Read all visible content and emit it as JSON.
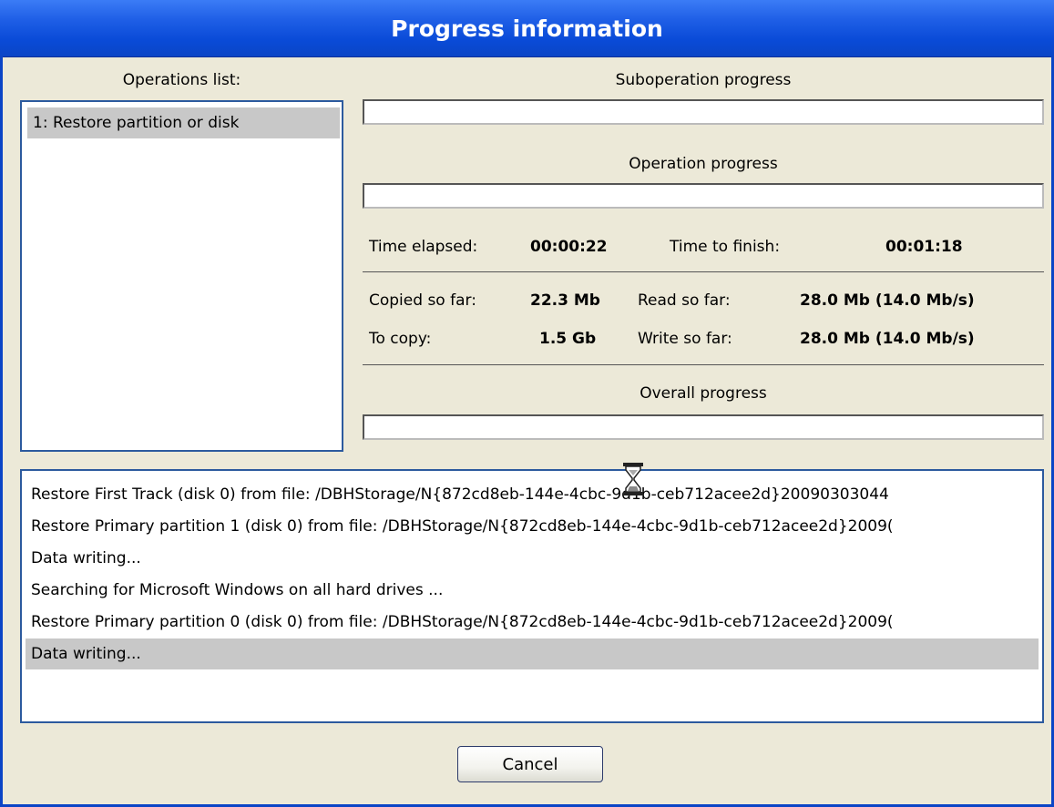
{
  "window": {
    "title": "Progress information"
  },
  "operations": {
    "label": "Operations list:",
    "items": [
      "1: Restore partition or disk"
    ]
  },
  "suboperation": {
    "label": "Suboperation progress",
    "progress": 0
  },
  "operation": {
    "label": "Operation progress",
    "progress": 0
  },
  "stats": {
    "time_elapsed_label": "Time elapsed:",
    "time_elapsed_value": "00:00:22",
    "time_to_finish_label": "Time to finish:",
    "time_to_finish_value": "00:01:18",
    "copied_label": "Copied so far:",
    "copied_value": "22.3 Mb",
    "read_label": "Read so far:",
    "read_value": "28.0 Mb (14.0 Mb/s)",
    "to_copy_label": "To copy:",
    "to_copy_value": "1.5 Gb",
    "write_label": "Write so far:",
    "write_value": "28.0 Mb (14.0 Mb/s)"
  },
  "overall": {
    "label": "Overall progress",
    "progress": 0
  },
  "log": [
    "Restore First Track (disk 0) from file: /DBHStorage/N{872cd8eb-144e-4cbc-9d1b-ceb712acee2d}20090303044",
    "Restore Primary partition 1 (disk 0) from file: /DBHStorage/N{872cd8eb-144e-4cbc-9d1b-ceb712acee2d}2009(",
    "Data writing...",
    "Searching for Microsoft Windows on all hard drives ...",
    "Restore Primary partition 0 (disk 0) from file: /DBHStorage/N{872cd8eb-144e-4cbc-9d1b-ceb712acee2d}2009(",
    "Data writing..."
  ],
  "cancel_label": "Cancel",
  "icons": {
    "cursor": "hourglass-icon"
  },
  "colors": {
    "title_bar": "#0b45c6",
    "border": "#2c5a9e",
    "selection": "#c8c8c8"
  }
}
